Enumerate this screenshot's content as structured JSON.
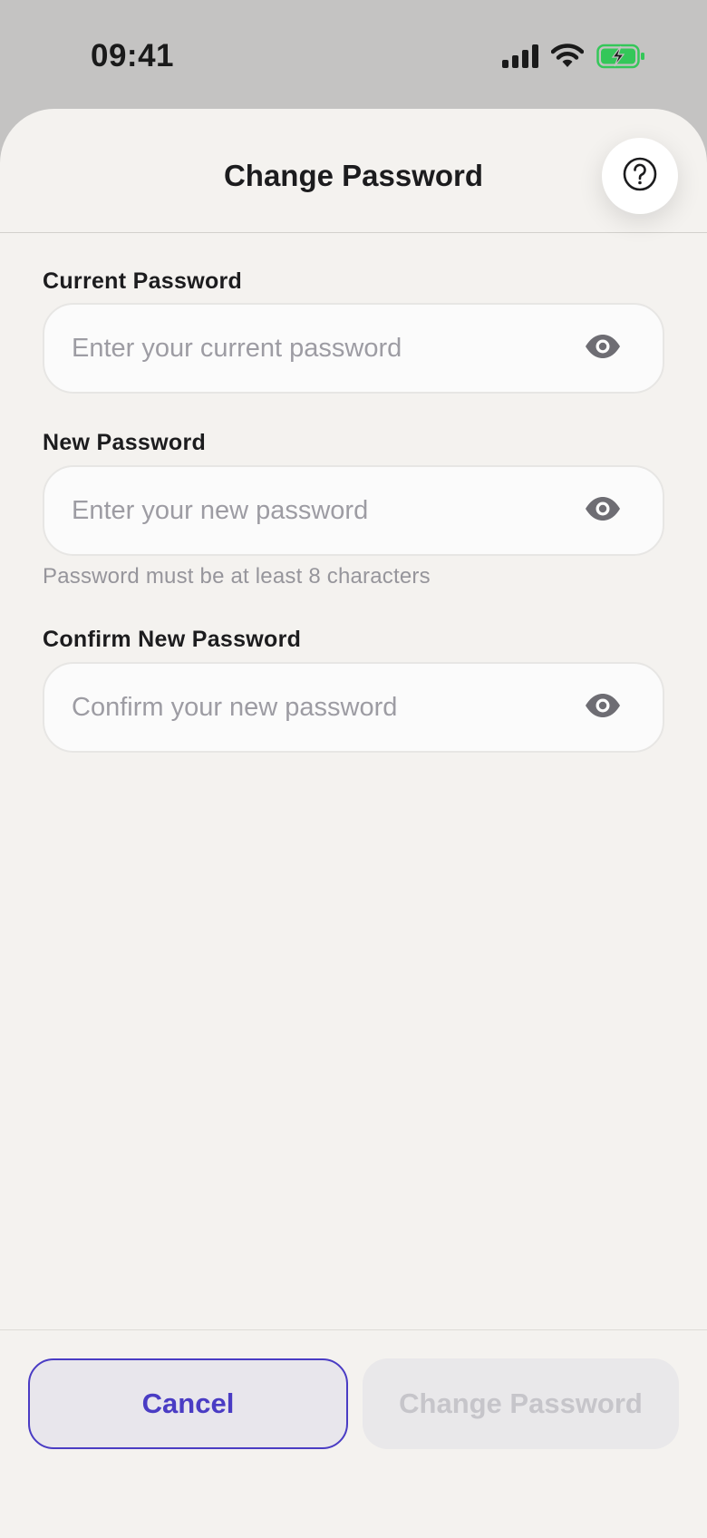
{
  "status_bar": {
    "time": "09:41",
    "icons": [
      "cellular-signal-icon",
      "wifi-icon",
      "battery-charging-icon"
    ],
    "battery_color": "#34c759"
  },
  "header": {
    "title": "Change Password",
    "help_icon": "question-circle-icon"
  },
  "form": {
    "current": {
      "label": "Current Password",
      "placeholder": "Enter your current password",
      "value": "",
      "toggle_icon": "eye-icon"
    },
    "new": {
      "label": "New Password",
      "placeholder": "Enter your new password",
      "value": "",
      "helper": "Password must be at least 8 characters",
      "toggle_icon": "eye-icon"
    },
    "confirm": {
      "label": "Confirm New Password",
      "placeholder": "Confirm your new password",
      "value": "",
      "toggle_icon": "eye-icon"
    }
  },
  "footer": {
    "cancel_label": "Cancel",
    "submit_label": "Change Password",
    "submit_disabled": true
  },
  "colors": {
    "accent": "#4a3cc4",
    "background": "#f4f2ef",
    "disabled_text": "#c6c5ca"
  }
}
